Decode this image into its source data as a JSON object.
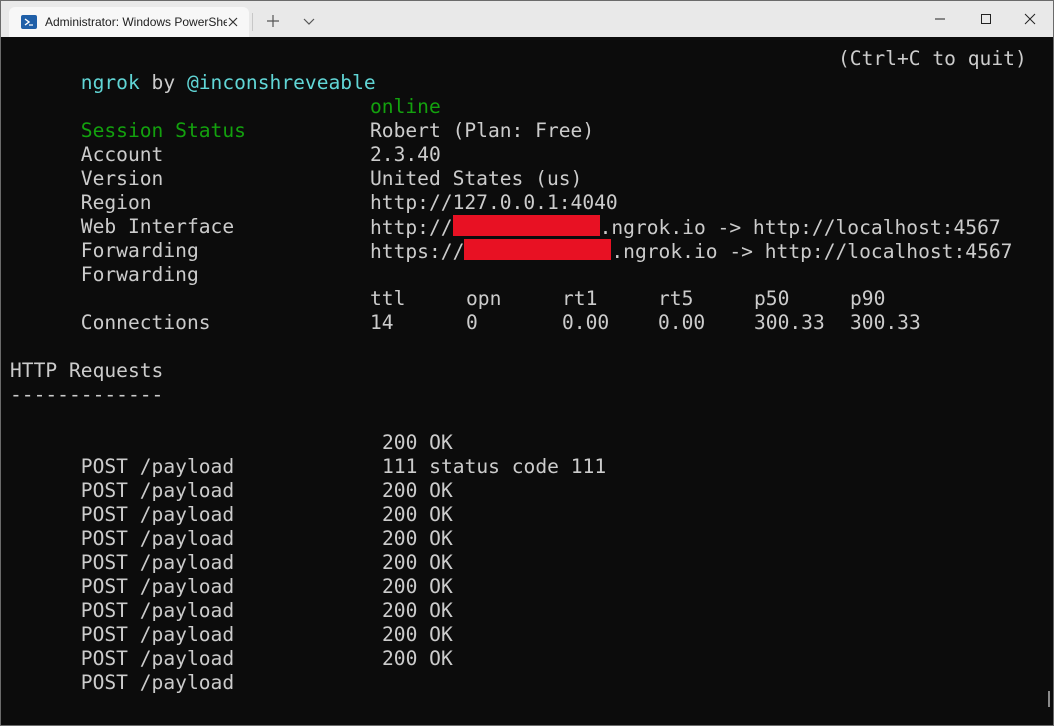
{
  "window": {
    "tab_title": "Administrator: Windows PowerShell",
    "tab_icon": "powershell-icon",
    "controls": {
      "minimize": "minimize-icon",
      "maximize": "maximize-icon",
      "close": "close-icon"
    }
  },
  "terminal": {
    "header_left_app": "ngrok",
    "header_left_by": " by ",
    "header_left_author": "@inconshreveable",
    "header_right": "(Ctrl+C to quit)",
    "status": {
      "session_label": "Session Status",
      "session_value": "online",
      "account_label": "Account",
      "account_value": "Robert (Plan: Free)",
      "version_label": "Version",
      "version_value": "2.3.40",
      "region_label": "Region",
      "region_value": "United States (us)",
      "web_label": "Web Interface",
      "web_value": "http://127.0.0.1:4040",
      "forwarding_label": "Forwarding",
      "fwd1_prefix": "http://",
      "fwd1_suffix": ".ngrok.io -> http://localhost:4567",
      "fwd2_prefix": "https://",
      "fwd2_suffix": ".ngrok.io -> http://localhost:4567"
    },
    "connections": {
      "label": "Connections",
      "headers": [
        "ttl",
        "opn",
        "rt1",
        "rt5",
        "p50",
        "p90"
      ],
      "values": [
        "14",
        "0",
        "0.00",
        "0.00",
        "300.33",
        "300.33"
      ]
    },
    "requests": {
      "title": "HTTP Requests",
      "underline": "-------------",
      "rows": [
        {
          "request": "POST /payload",
          "status": "200 OK"
        },
        {
          "request": "POST /payload",
          "status": "111 status code 111"
        },
        {
          "request": "POST /payload",
          "status": "200 OK"
        },
        {
          "request": "POST /payload",
          "status": "200 OK"
        },
        {
          "request": "POST /payload",
          "status": "200 OK"
        },
        {
          "request": "POST /payload",
          "status": "200 OK"
        },
        {
          "request": "POST /payload",
          "status": "200 OK"
        },
        {
          "request": "POST /payload",
          "status": "200 OK"
        },
        {
          "request": "POST /payload",
          "status": "200 OK"
        },
        {
          "request": "POST /payload",
          "status": "200 OK"
        }
      ]
    }
  },
  "colors": {
    "background": "#0c0c0c",
    "text": "#cccccc",
    "cyan": "#61d6d6",
    "green": "#13a10e",
    "redaction": "#e81123",
    "titlebar": "#e9e9e9"
  }
}
